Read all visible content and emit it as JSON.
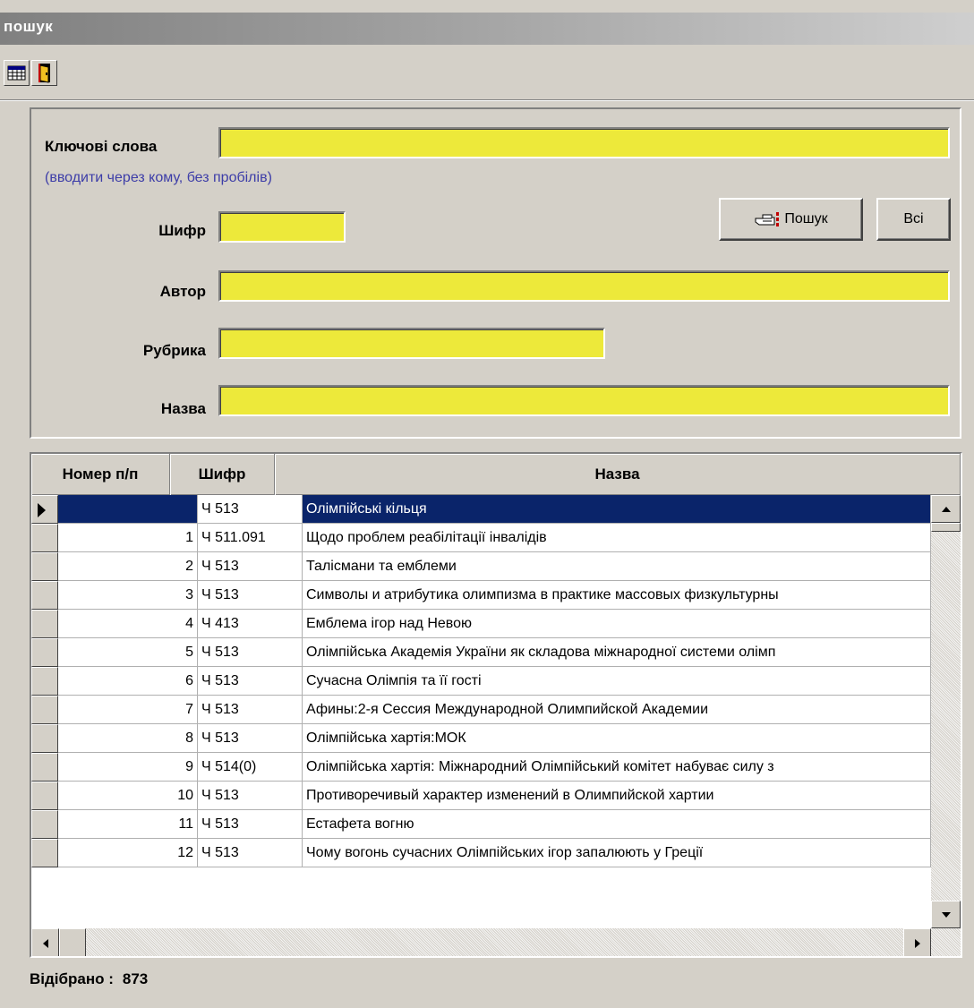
{
  "window": {
    "title": "пошук"
  },
  "toolbar": {
    "icons": [
      "table-icon",
      "exit-door-icon"
    ]
  },
  "form": {
    "keywords": {
      "label": "Ключові слова",
      "hint": "(вводити через кому, без пробілів)",
      "value": ""
    },
    "code": {
      "label": "Шифр",
      "value": ""
    },
    "author": {
      "label": "Автор",
      "value": ""
    },
    "rubric": {
      "label": "Рубрика",
      "value": ""
    },
    "title": {
      "label": "Назва",
      "value": ""
    },
    "search_button": "Пошук",
    "all_button": "Всі"
  },
  "colors": {
    "field_bg": "#ede93a",
    "selection": "#0a246a",
    "hint": "#3d3da8"
  },
  "table": {
    "columns": [
      "Номер п/п",
      "Шифр",
      "Назва"
    ],
    "rows": [
      {
        "num": "",
        "code": "Ч 513",
        "title": "Олімпійські кільця",
        "selected": true
      },
      {
        "num": "1",
        "code": "Ч 511.091",
        "title": "Щодо проблем реабілітації інвалідів"
      },
      {
        "num": "2",
        "code": "Ч 513",
        "title": "Талісмани та емблеми"
      },
      {
        "num": "3",
        "code": "Ч 513",
        "title": "Символы и атрибутика олимпизма в практике массовых физкультурны"
      },
      {
        "num": "4",
        "code": "Ч 413",
        "title": "Емблема ігор над Невою"
      },
      {
        "num": "5",
        "code": "Ч 513",
        "title": "Олімпійська Академія України як складова міжнародної системи олімп"
      },
      {
        "num": "6",
        "code": "Ч 513",
        "title": "Сучасна Олімпія та її гості"
      },
      {
        "num": "7",
        "code": "Ч 513",
        "title": "Афины:2-я Сессия Международной Олимпийской Академии"
      },
      {
        "num": "8",
        "code": "Ч 513",
        "title": "Олімпійська хартія:МОК"
      },
      {
        "num": "9",
        "code": "Ч 514(0)",
        "title": "Олімпійська хартія: Міжнародний Олімпійський комітет набуває силу з"
      },
      {
        "num": "10",
        "code": "Ч 513",
        "title": "Противоречивый характер изменений в Олимпийской хартии"
      },
      {
        "num": "11",
        "code": "Ч 513",
        "title": "Естафета вогню"
      },
      {
        "num": "12",
        "code": "Ч 513",
        "title": "Чому вогонь сучасних Олімпійських ігор запалюють у Греції"
      }
    ]
  },
  "status": {
    "label": "Відібрано :",
    "count": "873"
  }
}
